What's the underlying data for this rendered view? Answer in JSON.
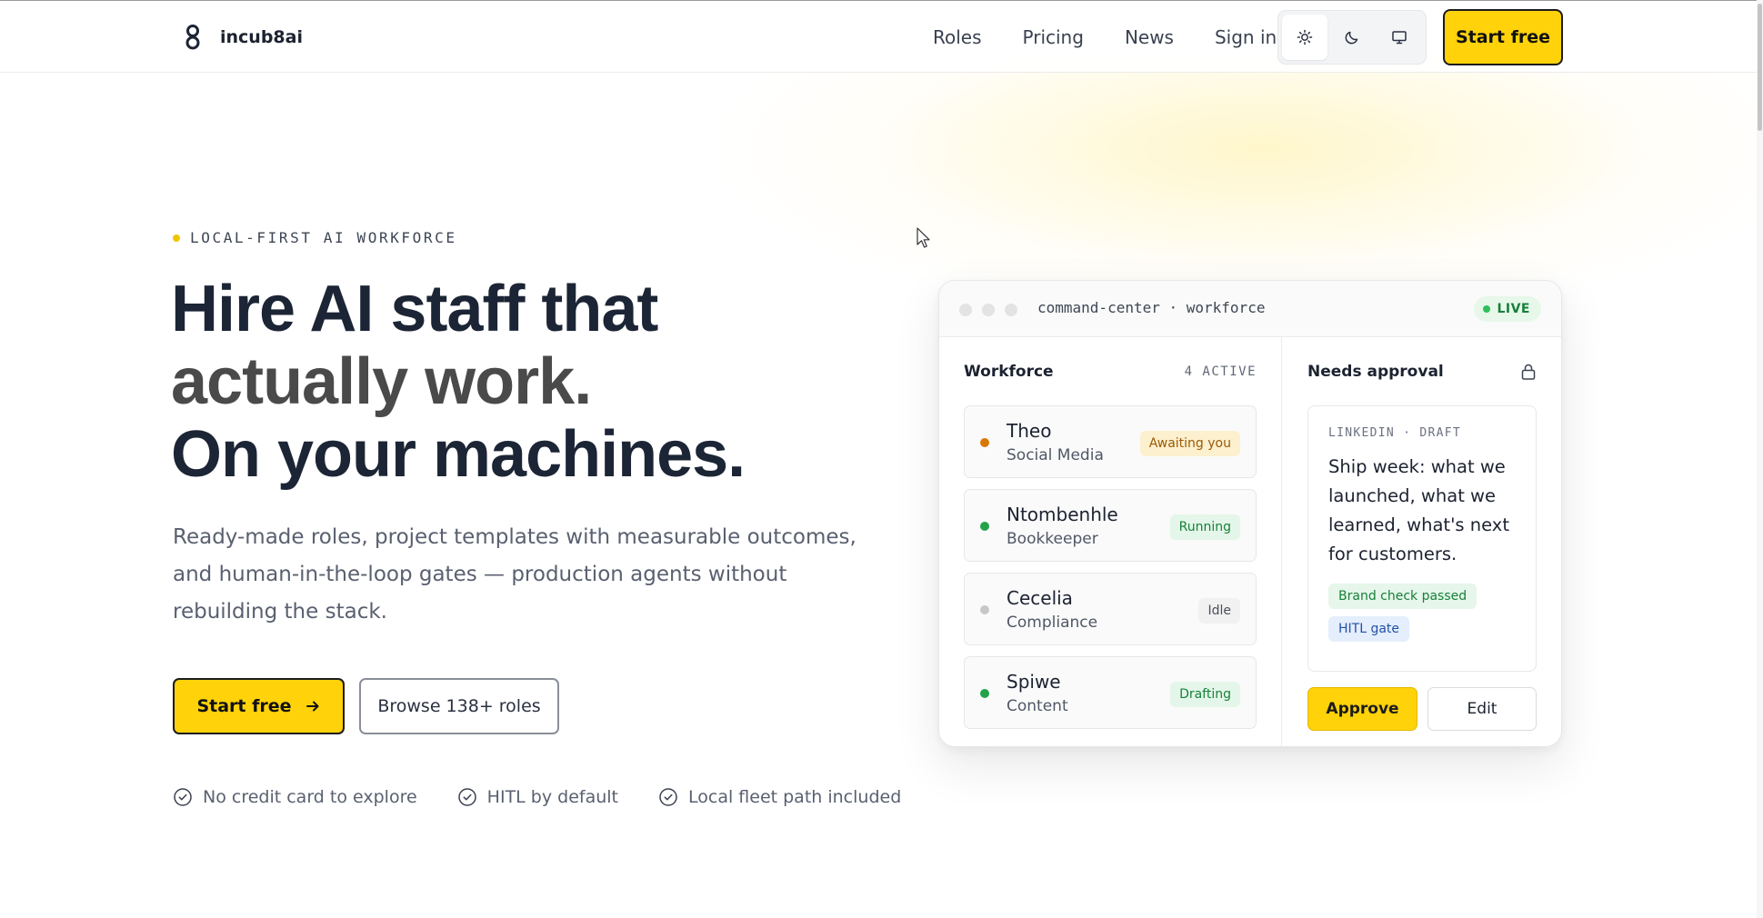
{
  "nav": {
    "brand": "incub8ai",
    "links": [
      "Roles",
      "Pricing",
      "News",
      "Sign in"
    ],
    "theme_options": [
      {
        "icon": "sun-icon",
        "active": true
      },
      {
        "icon": "moon-icon",
        "active": false
      },
      {
        "icon": "monitor-icon",
        "active": false
      }
    ],
    "cta": "Start free"
  },
  "hero": {
    "eyebrow": "LOCAL-FIRST AI WORKFORCE",
    "headline_line1": "Hire AI staff that",
    "headline_line2": "actually work.",
    "headline_line3": "On your machines.",
    "subcopy": "Ready-made roles, project templates with measurable outcomes, and human-in-the-loop gates — production agents without rebuilding the stack.",
    "primary_cta": "Start free",
    "secondary_cta": "Browse 138+ roles",
    "checks": [
      "No credit card to explore",
      "HITL by default",
      "Local fleet path included"
    ]
  },
  "console": {
    "title": "command-center · workforce",
    "status": "LIVE",
    "workforce_title": "Workforce",
    "workforce_count": "4 ACTIVE",
    "staff": [
      {
        "name": "Theo",
        "role": "Social Media",
        "status": "Awaiting you",
        "dot": "#d97706",
        "badge_bg": "#fdf0cf",
        "badge_fg": "#9a5a05"
      },
      {
        "name": "Ntombenhle",
        "role": "Bookkeeper",
        "status": "Running",
        "dot": "#22a34a",
        "badge_bg": "#e4f6e9",
        "badge_fg": "#17803a"
      },
      {
        "name": "Cecelia",
        "role": "Compliance",
        "status": "Idle",
        "dot": "#c7c7c7",
        "badge_bg": "#f1f1f1",
        "badge_fg": "#4a4f5a"
      },
      {
        "name": "Spiwe",
        "role": "Content",
        "status": "Drafting",
        "dot": "#22a34a",
        "badge_bg": "#e4f6e9",
        "badge_fg": "#17803a"
      }
    ],
    "approval_title": "Needs approval",
    "draft_label": "LINKEDIN · DRAFT",
    "draft_text": "Ship week: what we launched, what we learned, what's next for customers.",
    "tag_brand": "Brand check passed",
    "tag_hitl": "HITL gate",
    "approve_label": "Approve",
    "edit_label": "Edit"
  },
  "colors": {
    "accent": "#ffd20a",
    "heading": "#1c2535"
  }
}
